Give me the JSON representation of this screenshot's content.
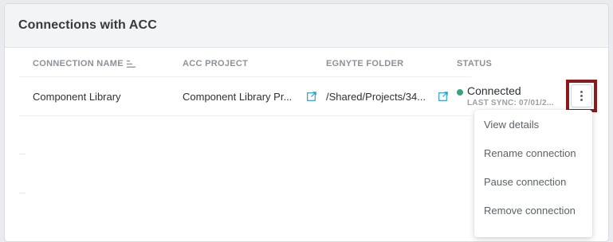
{
  "panel": {
    "title": "Connections with ACC"
  },
  "table": {
    "columns": [
      "CONNECTION NAME",
      "ACC PROJECT",
      "EGNYTE FOLDER",
      "STATUS"
    ],
    "rows": [
      {
        "connection_name": "Component Library",
        "acc_project": "Component Library Pr...",
        "egnyte_folder": "/Shared/Projects/34...",
        "status": "Connected",
        "last_sync": "LAST SYNC: 07/01/2..."
      }
    ]
  },
  "menu": {
    "items": [
      "View details",
      "Rename connection",
      "Pause connection",
      "Remove connection"
    ]
  },
  "colors": {
    "status_connected": "#3aa37e",
    "link_icon": "#2aa3c9",
    "highlight_border": "#8b1a1a"
  },
  "icons": {
    "sort": "sort-icon",
    "external_link": "external-link-icon",
    "kebab": "more-vertical-icon"
  }
}
